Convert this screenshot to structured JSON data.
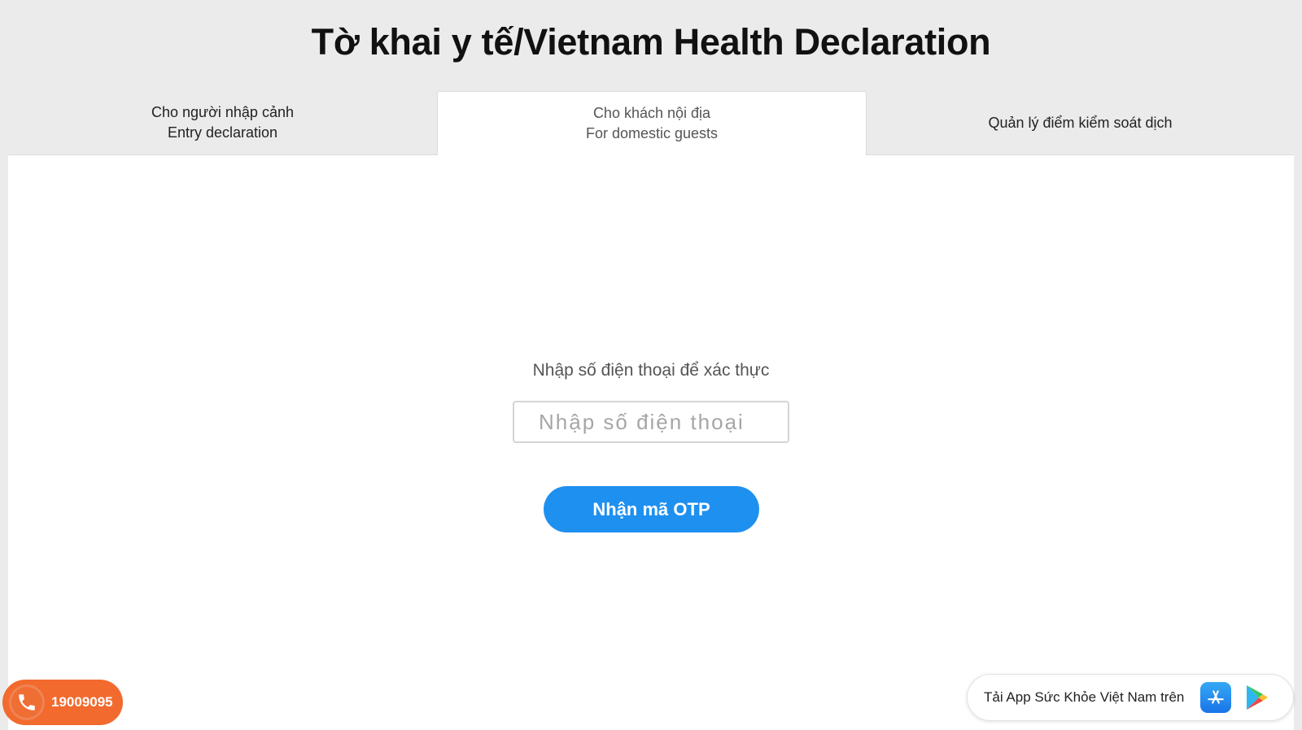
{
  "header": {
    "title": "Tờ khai y tế/Vietnam Health Declaration"
  },
  "tabs": [
    {
      "line1": "Cho người nhập cảnh",
      "line2": "Entry declaration"
    },
    {
      "line1": "Cho khách nội địa",
      "line2": "For domestic guests",
      "active": true
    },
    {
      "line1": "Quản lý điểm kiểm soát dịch"
    }
  ],
  "form": {
    "prompt": "Nhập số điện thoại để xác thực",
    "phone_placeholder": "Nhập số điện thoại",
    "phone_value": "",
    "submit_label": "Nhận mã OTP"
  },
  "hotline": {
    "number": "19009095",
    "icon": "phone-icon"
  },
  "app_banner": {
    "text": "Tải App Sức Khỏe Việt Nam trên",
    "icons": [
      "app-store-icon",
      "google-play-icon"
    ]
  },
  "colors": {
    "accent": "#1e90f0",
    "hotline": "#f26a2e",
    "background": "#ebebeb"
  }
}
